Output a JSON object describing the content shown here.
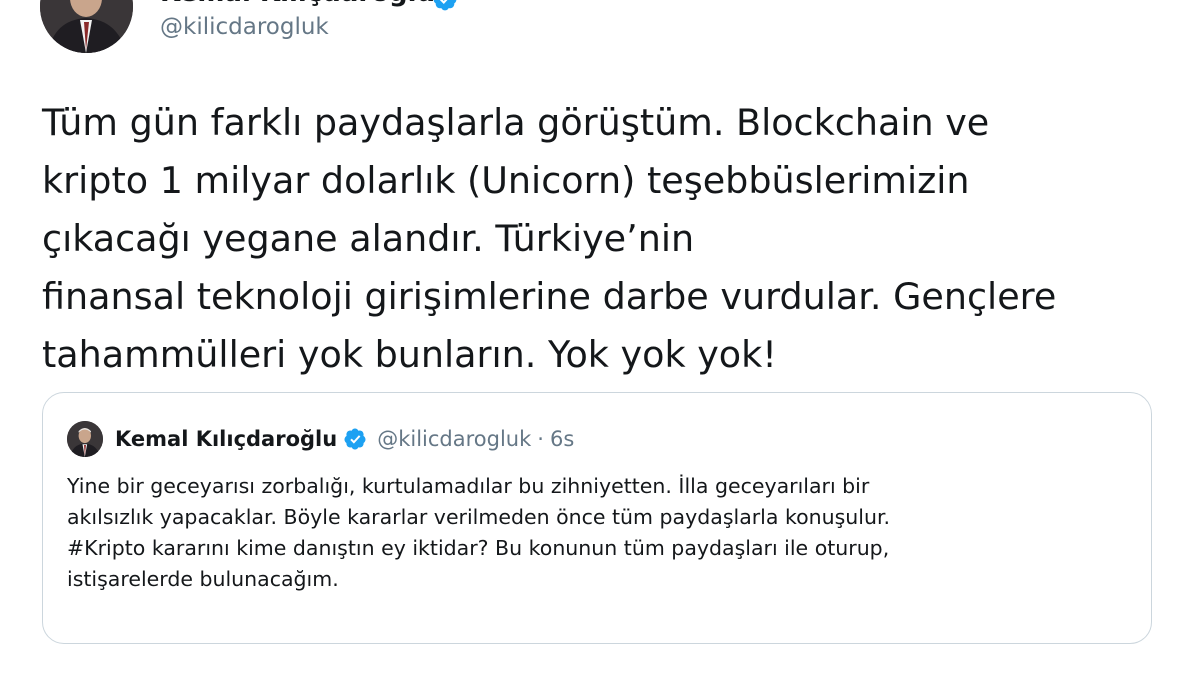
{
  "author": {
    "name": "Kemal Kılıçdaroğlu",
    "handle": "@kilicdarogluk"
  },
  "tweet": {
    "lines": [
      "Tüm gün farklı paydaşlarla görüştüm. Blockchain ve",
      "kripto 1 milyar dolarlık (Unicorn) teşebbüslerimizin",
      "çıkacağı yegane alandır. Türkiye’nin",
      "finansal teknoloji girişimlerine darbe vurdular. Gençlere",
      "tahammülleri yok bunların. Yok yok yok!"
    ]
  },
  "quoted_tweet": {
    "name": "Kemal Kılıçdaroğlu",
    "handle": "@kilicdarogluk",
    "separator": "·",
    "time": "6s",
    "lines": [
      "Yine bir geceyarısı zorbalığı,  kurtulamadılar bu zihniyetten. İlla geceyarıları bir",
      "akılsızlık yapacaklar. Böyle kararlar verilmeden önce tüm paydaşlarla konuşulur.",
      "#Kripto kararını kime danıştın ey iktidar? Bu konunun tüm paydaşları ile oturup,",
      "istişarelerde bulunacağım."
    ]
  },
  "icons": {
    "verified": "verified-badge-icon"
  },
  "colors": {
    "text": "#14171a",
    "secondary": "#657786",
    "verified": "#1da1f2",
    "border": "#ccd6dd"
  }
}
